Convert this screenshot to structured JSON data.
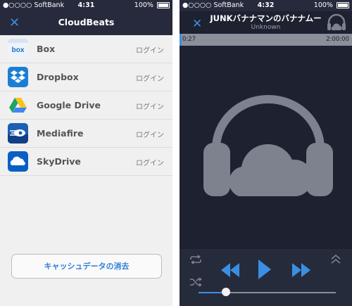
{
  "left_screen": {
    "status": {
      "carrier": "●○○○○ SoftBank",
      "time": "4:31",
      "battery": "100%"
    },
    "nav": {
      "close": "✕",
      "title": "CloudBeats"
    },
    "services": [
      {
        "name": "Box",
        "action": "ログイン",
        "icon": "box-icon"
      },
      {
        "name": "Dropbox",
        "action": "ログイン",
        "icon": "dropbox-icon"
      },
      {
        "name": "Google Drive",
        "action": "ログイン",
        "icon": "google-drive-icon"
      },
      {
        "name": "Mediafire",
        "action": "ログイン",
        "icon": "mediafire-icon"
      },
      {
        "name": "SkyDrive",
        "action": "ログイン",
        "icon": "skydrive-icon"
      }
    ],
    "clear_cache_label": "キャッシュデータの消去"
  },
  "right_screen": {
    "status": {
      "carrier": "●○○○○ SoftBank",
      "time": "4:32",
      "battery": "100%"
    },
    "nav": {
      "close": "✕"
    },
    "track": {
      "title": "JUNKバナナマンのバナナムー",
      "artist": "Unknown"
    },
    "progress": {
      "elapsed": "0:27",
      "duration": "2:00:00",
      "fraction": 0.004
    },
    "volume_fraction": 0.2
  },
  "colors": {
    "accent": "#3b8fe2",
    "dark_bg": "#1d2130",
    "bar_bg": "#262a3c",
    "art": "#7e828f"
  }
}
